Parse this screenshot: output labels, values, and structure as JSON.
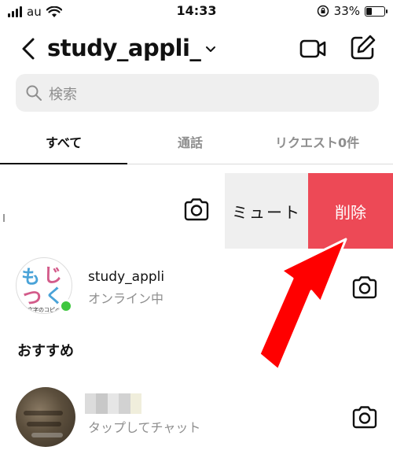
{
  "status_bar": {
    "carrier": "au",
    "time": "14:33",
    "battery": "33%",
    "battery_level": 0.33
  },
  "header": {
    "title": "study_appli_",
    "icons": [
      "back-icon",
      "chevron-down-icon",
      "video-camera-icon",
      "edit-icon"
    ]
  },
  "search": {
    "placeholder": "検索"
  },
  "tabs": {
    "all": "すべて",
    "calls": "通話",
    "requests": "リクエスト0件"
  },
  "swipe_actions": {
    "mute": "ミュート",
    "delete": "削除",
    "colors": {
      "mute_bg": "#efefef",
      "delete_bg": "#ed4956"
    }
  },
  "conversation": {
    "name": "study_appli",
    "status": "オンライン中",
    "avatar_logo": "もじつく",
    "avatar_caption": "文字のコピペ",
    "online": true
  },
  "suggestions": {
    "title": "おすすめ",
    "items": [
      {
        "subtitle": "タップしてチャット"
      }
    ]
  },
  "annotation": {
    "arrow_color": "#ff0000",
    "arrow_target": "delete"
  }
}
